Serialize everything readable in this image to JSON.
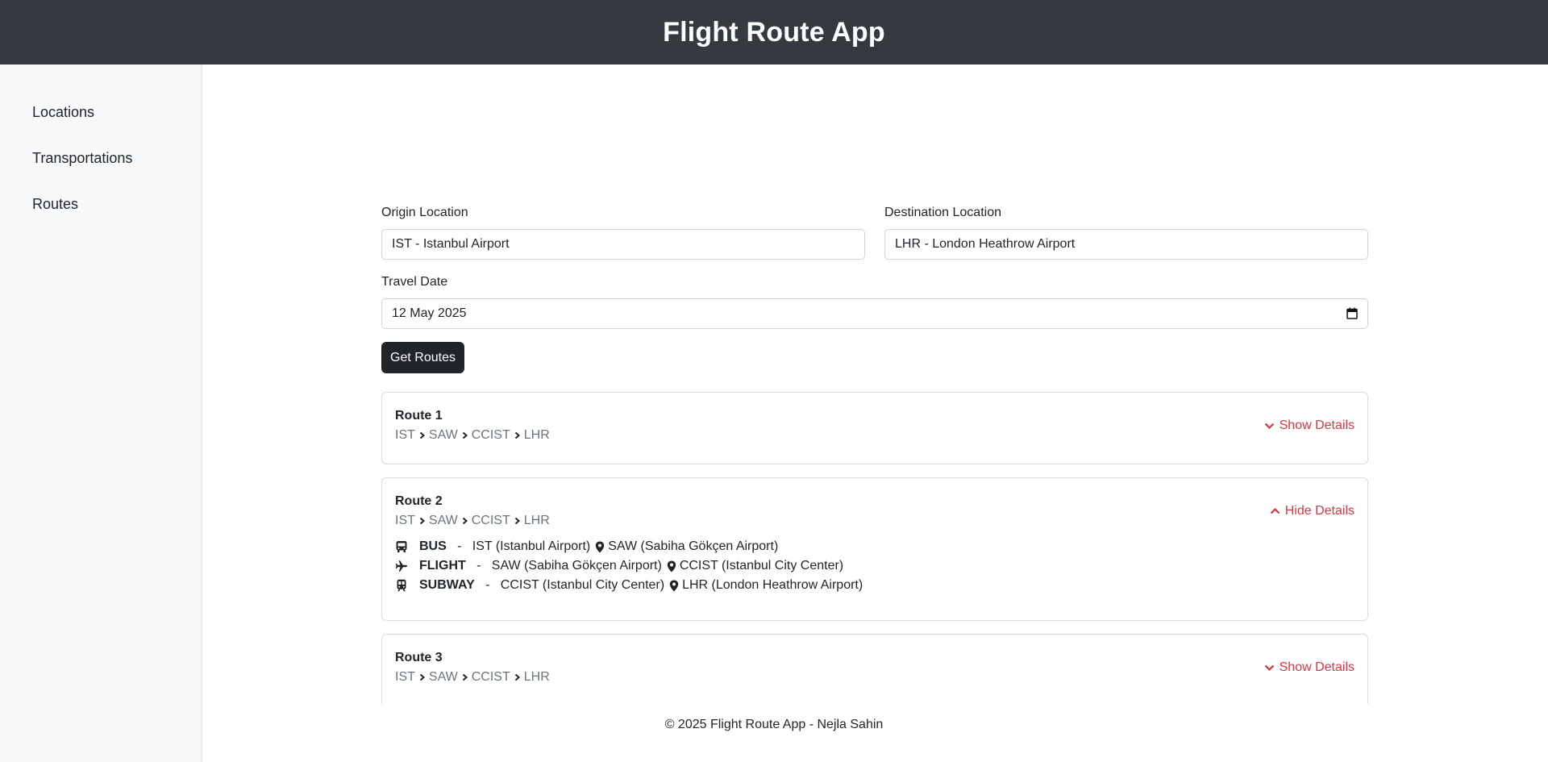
{
  "app": {
    "title": "Flight Route App"
  },
  "sidebar": {
    "items": [
      {
        "label": "Locations"
      },
      {
        "label": "Transportations"
      },
      {
        "label": "Routes"
      }
    ]
  },
  "form": {
    "origin": {
      "label": "Origin Location",
      "value": "IST - Istanbul Airport"
    },
    "destination": {
      "label": "Destination Location",
      "value": "LHR - London Heathrow Airport"
    },
    "date": {
      "label": "Travel Date",
      "value": "12 May 2025"
    },
    "submit_label": "Get Routes"
  },
  "routes": [
    {
      "title": "Route 1",
      "stops": [
        "IST",
        "SAW",
        "CCIST",
        "LHR"
      ],
      "toggle_label": "Show Details",
      "toggle_icon": "chevron-down-icon"
    },
    {
      "title": "Route 2",
      "stops": [
        "IST",
        "SAW",
        "CCIST",
        "LHR"
      ],
      "toggle_label": "Hide Details",
      "toggle_icon": "chevron-up-icon",
      "segments": [
        {
          "mode": "BUS",
          "icon": "bus-icon",
          "from": "IST (Istanbul Airport)",
          "to": "SAW (Sabiha Gökçen Airport)"
        },
        {
          "mode": "FLIGHT",
          "icon": "airplane-icon",
          "from": "SAW (Sabiha Gökçen Airport)",
          "to": "CCIST (Istanbul City Center)"
        },
        {
          "mode": "SUBWAY",
          "icon": "train-icon",
          "from": "CCIST (Istanbul City Center)",
          "to": "LHR (London Heathrow Airport)"
        }
      ]
    },
    {
      "title": "Route 3",
      "stops": [
        "IST",
        "SAW",
        "CCIST",
        "LHR"
      ],
      "toggle_label": "Show Details",
      "toggle_icon": "chevron-down-icon"
    }
  ],
  "footer": {
    "text": "© 2025 Flight Route App - Nejla Sahin"
  },
  "colors": {
    "header_bg": "#343a40",
    "sidebar_bg": "#f8f9fa",
    "button_bg": "#212529",
    "toggle": "#dc3545",
    "muted": "#6c757d"
  }
}
